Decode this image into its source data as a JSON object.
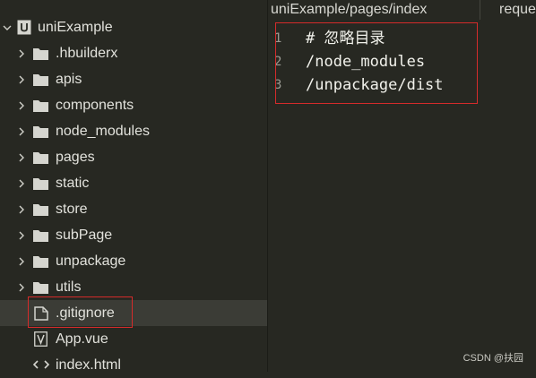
{
  "sidebar": {
    "project": {
      "name": "uniExample",
      "icon": "project-u-icon",
      "expanded": true
    },
    "items": [
      {
        "label": ".hbuilderx",
        "type": "folder"
      },
      {
        "label": "apis",
        "type": "folder"
      },
      {
        "label": "components",
        "type": "folder"
      },
      {
        "label": "node_modules",
        "type": "folder"
      },
      {
        "label": "pages",
        "type": "folder"
      },
      {
        "label": "static",
        "type": "folder"
      },
      {
        "label": "store",
        "type": "folder"
      },
      {
        "label": "subPage",
        "type": "folder"
      },
      {
        "label": "unpackage",
        "type": "folder"
      },
      {
        "label": "utils",
        "type": "folder"
      },
      {
        "label": ".gitignore",
        "type": "file",
        "selected": true
      },
      {
        "label": "App.vue",
        "type": "vue-file"
      },
      {
        "label": "index.html",
        "type": "html-file"
      }
    ]
  },
  "tabs": [
    {
      "label": "uniExample/pages/index"
    },
    {
      "label": "reque"
    }
  ],
  "editor": {
    "lines": [
      {
        "number": "1",
        "text": "# 忽略目录"
      },
      {
        "number": "2",
        "text": "/node_modules"
      },
      {
        "number": "3",
        "text": "/unpackage/dist"
      }
    ]
  },
  "watermark": "CSDN @扶园",
  "colors": {
    "background": "#272822",
    "selection": "#3b3c36",
    "highlight_box": "#d42b2b"
  }
}
